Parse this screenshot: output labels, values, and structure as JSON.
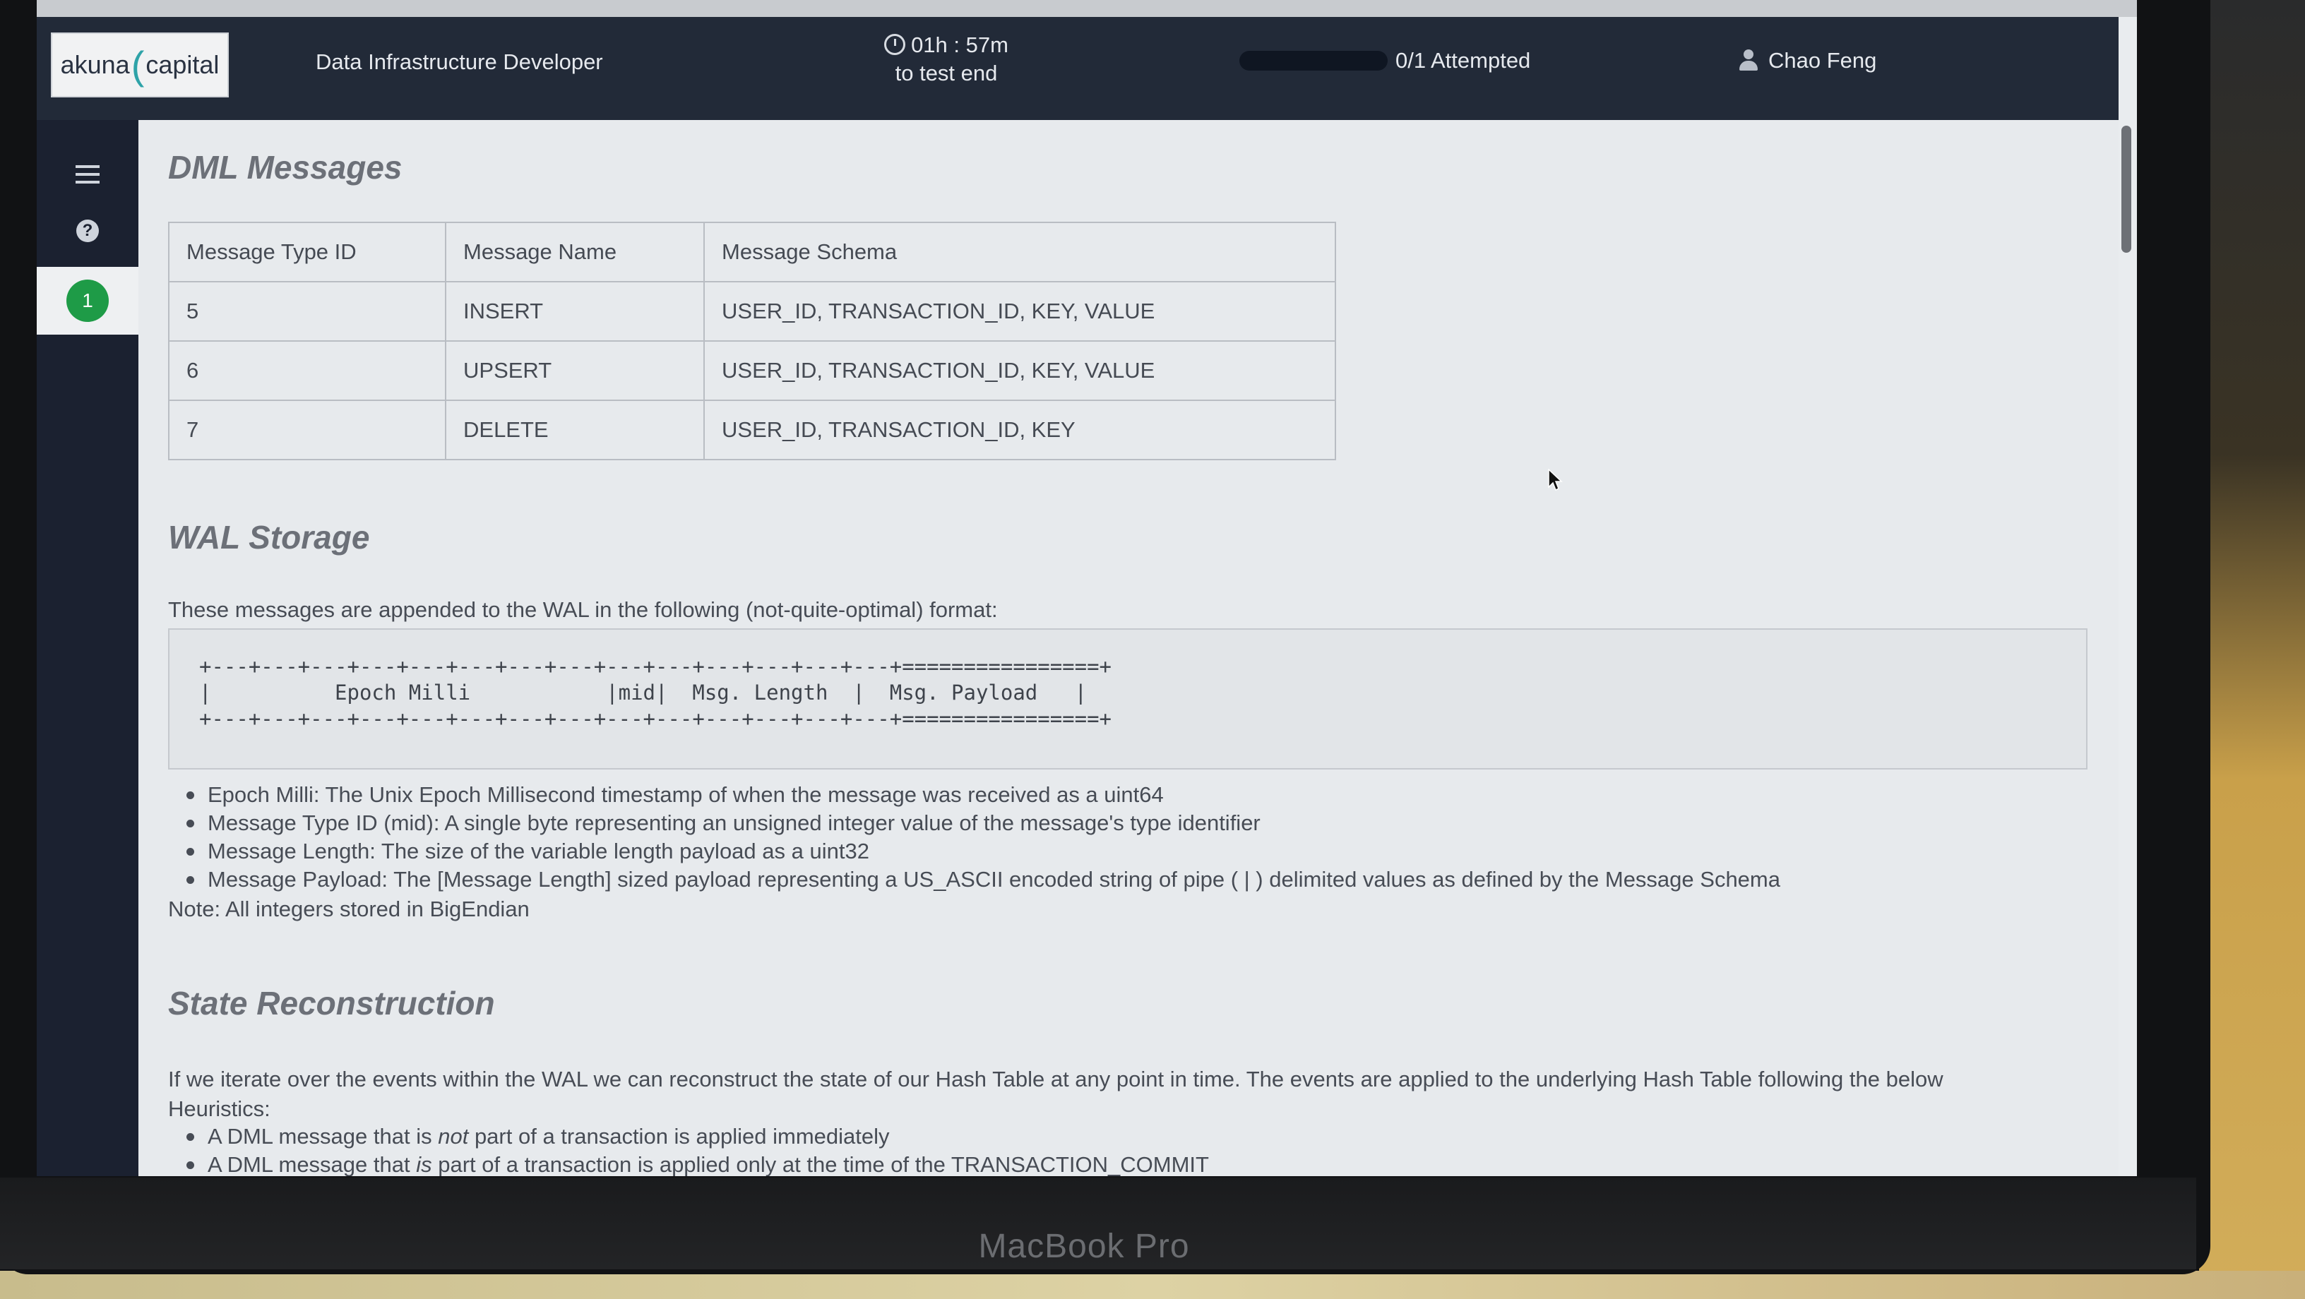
{
  "header": {
    "logo_text_left": "akuna",
    "logo_text_right": "capital",
    "job_title": "Data Infrastructure Developer",
    "timer": "01h : 57m",
    "timer_sub": "to test end",
    "attempted": "0/1 Attempted",
    "attempted_progress": 0,
    "user_name": "Chao Feng"
  },
  "sidebar": {
    "question_number": "1"
  },
  "dml": {
    "heading": "DML Messages",
    "columns": [
      "Message Type ID",
      "Message Name",
      "Message Schema"
    ],
    "rows": [
      [
        "5",
        "INSERT",
        "USER_ID,  TRANSACTION_ID,  KEY,  VALUE"
      ],
      [
        "6",
        "UPSERT",
        "USER_ID,  TRANSACTION_ID,  KEY,  VALUE"
      ],
      [
        "7",
        "DELETE",
        "USER_ID,  TRANSACTION_ID,  KEY"
      ]
    ]
  },
  "wal": {
    "heading": "WAL Storage",
    "intro": "These messages are appended to the WAL in the following (not-quite-optimal) format:",
    "code_line1": "+---+---+---+---+---+---+---+---+---+---+---+---+---+---+================+",
    "code_line2": "|          Epoch Milli           |mid|  Msg. Length  |  Msg. Payload   |",
    "code_line3": "+---+---+---+---+---+---+---+---+---+---+---+---+---+---+================+",
    "bullets": [
      "Epoch Milli: The Unix Epoch Millisecond timestamp of when the message was received as a uint64",
      "Message Type ID (mid): A single byte representing an unsigned integer value of the message's type identifier",
      "Message Length: The size of the variable length payload as a uint32",
      "Message Payload: The [Message Length] sized payload representing a US_ASCII encoded string of pipe ( | ) delimited values as defined by the Message Schema"
    ],
    "note": "Note: All integers stored in BigEndian"
  },
  "state": {
    "heading": "State Reconstruction",
    "para_line1": "If we iterate over the events within the WAL we can reconstruct the state of our Hash Table at any point in time. The events are applied to the underlying Hash Table following the below",
    "para_line2": "Heuristics:",
    "bullet1_pre": "A DML message that is ",
    "bullet1_em": "not",
    "bullet1_post": " part of a transaction is applied immediately",
    "bullet2_pre": "A DML message that ",
    "bullet2_em": "is",
    "bullet2_post": " part of a transaction is applied only at the time of the TRANSACTION_COMMIT"
  },
  "device": {
    "brand": "MacBook Pro"
  }
}
